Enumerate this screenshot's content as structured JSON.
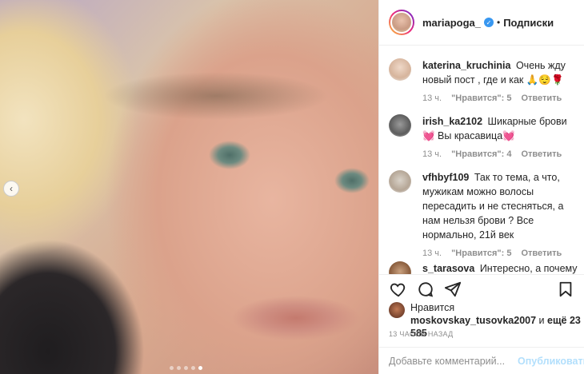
{
  "header": {
    "username": "mariapoga_",
    "separator": "•",
    "follow_label": "Подписки"
  },
  "comments": [
    {
      "username": "katerina_kruchinia",
      "text": "Очень жду новый пост , где и как 🙏😌🌹",
      "time": "13 ч.",
      "likes": "\"Нравится\": 5",
      "reply": "Ответить"
    },
    {
      "username": "irish_ka2102",
      "text": "Шикарные брови 💓 Вы красавица💓",
      "time": "13 ч.",
      "likes": "\"Нравится\": 4",
      "reply": "Ответить"
    },
    {
      "username": "vfhbyf109",
      "text": "Так то тема, а что, мужикам можно волосы пересадить и не стесняться, а нам нельзя брови ? Все нормально, 21й век",
      "time": "13 ч.",
      "likes": "\"Нравится\": 5",
      "reply": "Ответить"
    },
    {
      "username": "s_tarasova",
      "text": "Интересно, а почему",
      "time": "",
      "likes": "",
      "reply": ""
    }
  ],
  "liked_by": {
    "prefix": "Нравится",
    "user": "moskovskay_tusovka2007",
    "suffix_and": "и",
    "others": "ещё 23 585"
  },
  "timestamp": "13 ЧАСОВ НАЗАД",
  "add_comment": {
    "placeholder": "Добавьте комментарий...",
    "publish_label": "Опубликовать"
  },
  "colors": {
    "link_blue_disabled": "#b2dffc",
    "verified_blue": "#3897f0",
    "secondary_text": "#8e8e8e"
  }
}
